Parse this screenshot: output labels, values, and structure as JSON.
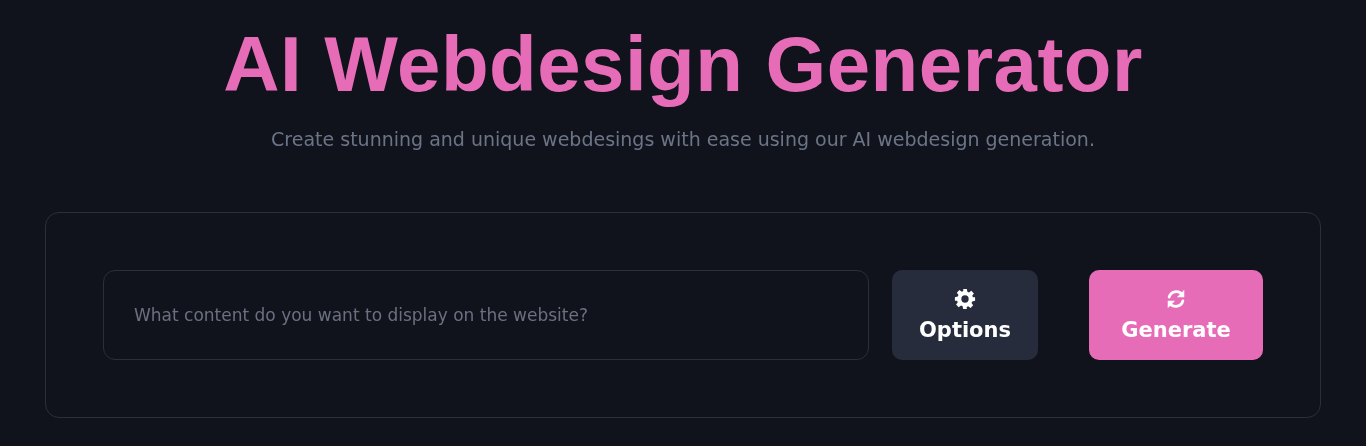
{
  "header": {
    "title": "AI Webdesign Generator",
    "subtitle": "Create stunning and unique webdesings with ease using our AI webdesign generation."
  },
  "form": {
    "prompt": {
      "placeholder": "What content do you want to display on the website?"
    },
    "buttons": [
      {
        "label": "Options",
        "kind": "secondary"
      },
      {
        "label": "Generate",
        "kind": "primary"
      }
    ]
  }
}
